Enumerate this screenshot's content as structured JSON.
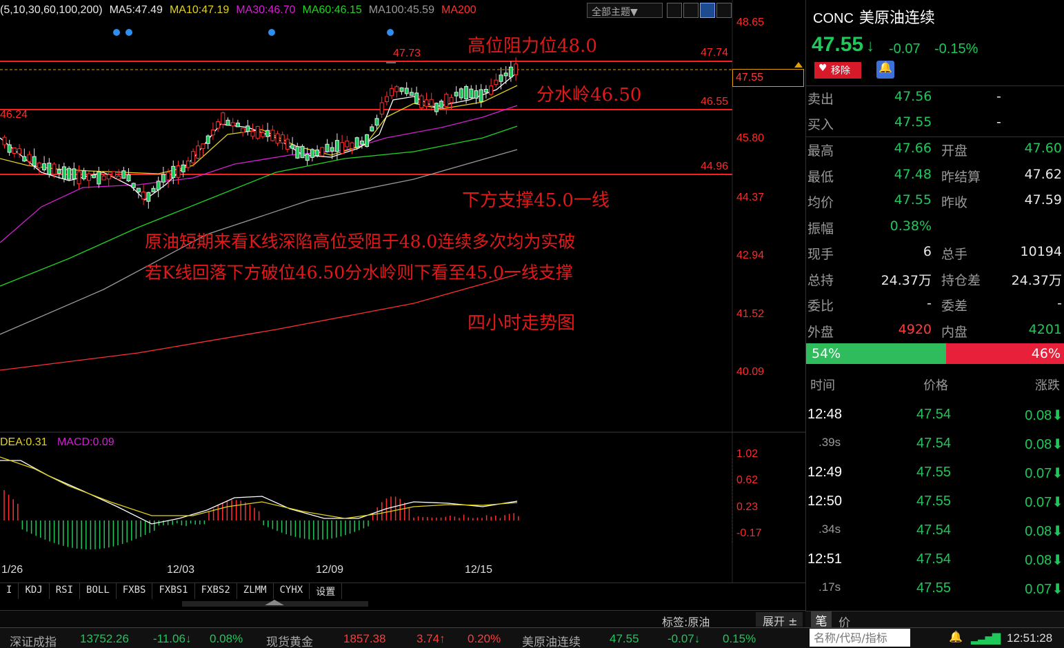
{
  "ma_legend": [
    {
      "label": "(5,10,30,60,100,200)",
      "color": "#e8e8e8"
    },
    {
      "label": "MA5:47.49",
      "color": "#e8e8e8"
    },
    {
      "label": "MA10:47.19",
      "color": "#e3d31c"
    },
    {
      "label": "MA30:46.70",
      "color": "#d41fd4"
    },
    {
      "label": "MA60:46.15",
      "color": "#21d421"
    },
    {
      "label": "MA100:45.59",
      "color": "#9a9a9a"
    },
    {
      "label": "MA200",
      "color": "#ff3030"
    }
  ],
  "toolbar": {
    "theme_label": "全部主题▼"
  },
  "annotations": {
    "resistance": "高位阻力位48.0",
    "watershed": "分水岭46.50",
    "support": "下方支撑45.0一线",
    "comment1": "原油短期来看K线深陷高位受阻于48.0连续多次均为实破",
    "comment2": "若K线回落下方破位46.50分水岭则下看至45.0一线支撑",
    "period": "四小时走势图"
  },
  "price_marks": {
    "high_label": "47.73",
    "left_label": "46.24",
    "line1": "47.74",
    "line2": "46.55",
    "line3": "44.96",
    "current": "47.55"
  },
  "y_axis": [
    "48.65",
    "45.80",
    "44.37",
    "42.94",
    "41.52",
    "40.09"
  ],
  "macd": {
    "dea": "DEA:0.31",
    "macd": "MACD:0.09",
    "axis": [
      "1.02",
      "0.62",
      "0.23",
      "-0.17"
    ]
  },
  "dates": [
    "1/26",
    "12/03",
    "12/09",
    "12/15"
  ],
  "indicator_tabs": [
    "I",
    "KDJ",
    "RSI",
    "BOLL",
    "FXBS",
    "FXBS1",
    "FXBS2",
    "ZLMM",
    "CYHX",
    "设置"
  ],
  "label_bar": {
    "tag": "标签:原油",
    "expand": "展开 ±"
  },
  "quote": {
    "code": "CONC",
    "name": "美原油连续",
    "price": "47.55",
    "arrow": "↓",
    "change": "-0.07",
    "change_pct": "-0.15%",
    "remove_label": "移除",
    "sell_label": "卖出",
    "sell_price": "47.56",
    "sell_vol": "-",
    "buy_label": "买入",
    "buy_price": "47.55",
    "buy_vol": "-",
    "rows": [
      {
        "k": "最高",
        "v": "47.66",
        "vc": "green",
        "k2": "开盘",
        "v2": "47.60",
        "v2c": "green"
      },
      {
        "k": "最低",
        "v": "47.48",
        "vc": "green",
        "k2": "昨结算",
        "v2": "47.62",
        "v2c": "white"
      },
      {
        "k": "均价",
        "v": "47.55",
        "vc": "green",
        "k2": "昨收",
        "v2": "47.59",
        "v2c": "white"
      },
      {
        "k": "振幅",
        "v": "0.38%",
        "vc": "green",
        "k2": "",
        "v2": "",
        "v2c": "white"
      },
      {
        "k": "现手",
        "v": "6",
        "vc": "white",
        "k2": "总手",
        "v2": "10194",
        "v2c": "white"
      },
      {
        "k": "总持",
        "v": "24.37万",
        "vc": "white",
        "k2": "持仓差",
        "v2": "24.37万",
        "v2c": "white"
      },
      {
        "k": "委比",
        "v": "-",
        "vc": "white",
        "k2": "委差",
        "v2": "-",
        "v2c": "white"
      },
      {
        "k": "外盘",
        "v": "4920",
        "vc": "red",
        "k2": "内盘",
        "v2": "4201",
        "v2c": "green"
      }
    ],
    "buy_ratio": "54%",
    "sell_ratio": "46%",
    "buy_ratio_value": 0.54
  },
  "ticks": {
    "headers": [
      "时间",
      "价格",
      "涨跌"
    ],
    "rows": [
      {
        "time": "12:48",
        "sub": false,
        "price": "47.54",
        "chg": "0.08"
      },
      {
        "time": ".39s",
        "sub": true,
        "price": "47.54",
        "chg": "0.08"
      },
      {
        "time": "12:49",
        "sub": false,
        "price": "47.55",
        "chg": "0.07"
      },
      {
        "time": "12:50",
        "sub": false,
        "price": "47.55",
        "chg": "0.07"
      },
      {
        "time": ".34s",
        "sub": true,
        "price": "47.54",
        "chg": "0.08"
      },
      {
        "time": "12:51",
        "sub": false,
        "price": "47.54",
        "chg": "0.08"
      },
      {
        "time": ".17s",
        "sub": true,
        "price": "47.55",
        "chg": "0.07"
      }
    ]
  },
  "bottom_tabs": {
    "stroke": "笔",
    "price": "价"
  },
  "status": {
    "idx1_name": "深证成指",
    "idx1_val": "13752.26",
    "idx1_chg": "-11.06↓",
    "idx1_pct": "0.08%",
    "idx2_name": "现货黄金",
    "idx2_val": "1857.38",
    "idx2_chg": "3.74↑",
    "idx2_pct": "0.20%",
    "idx3_name": "美原油连续",
    "idx3_val": "47.55",
    "idx3_chg": "-0.07↓",
    "idx3_pct": "0.15%",
    "search_placeholder": "名称/代码/指标",
    "clock": "12:51:28"
  }
}
